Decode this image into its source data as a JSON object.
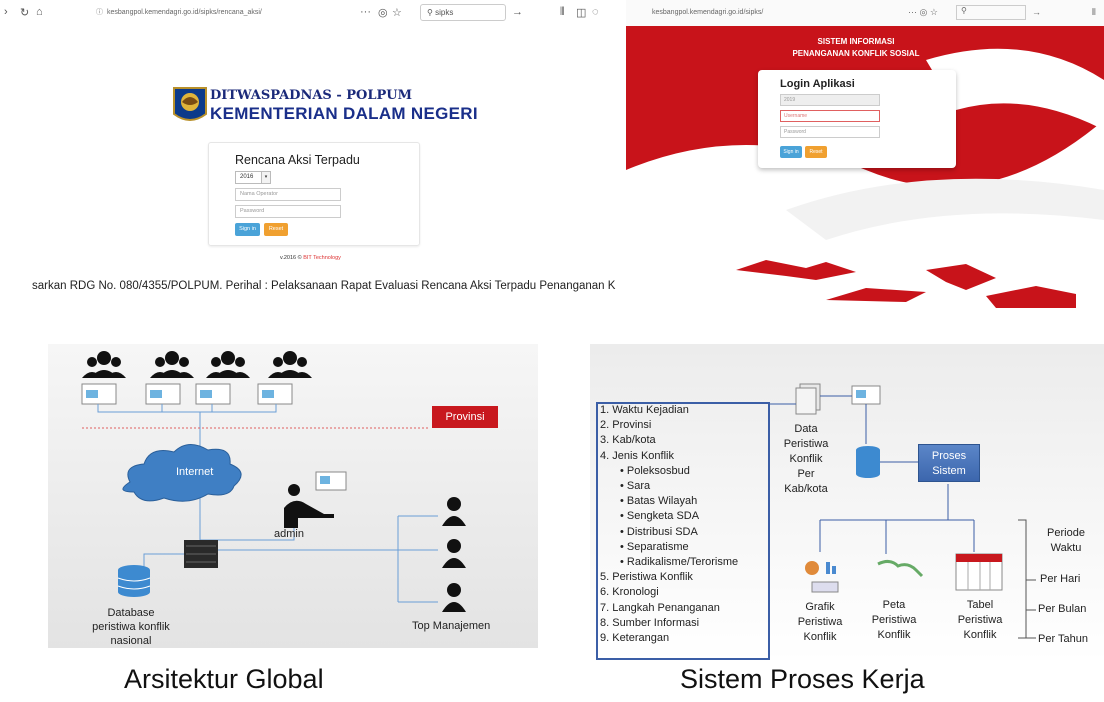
{
  "panel_a": {
    "url": "kesbangpol.kemendagri.go.id/sipks/rencana_aksi/",
    "search_value": "sipks",
    "org_line1": "DITWASPADNAS - POLPUM",
    "org_line2": "KEMENTERIAN DALAM NEGERI",
    "card_title": "Rencana Aksi Terpadu",
    "year_select": "2016",
    "operator_placeholder": "Nama Operator",
    "password_placeholder": "Password",
    "signin_label": "Sign in",
    "reset_label": "Reset",
    "footer_prefix": "v.2016 ©",
    "footer_brand": "BIT Technology",
    "marquee_text": "sarkan RDG No. 080/4355/POLPUM. Perihal : Pelaksanaan Rapat Evaluasi Rencana Aksi Terpadu Penanganan K"
  },
  "panel_b": {
    "url": "kesbangpol.kemendagri.go.id/sipks/",
    "header_line1": "SISTEM INFORMASI",
    "header_line2": "PENANGANAN KONFLIK SOSIAL",
    "card_title": "Login Aplikasi",
    "year_value": "2019",
    "username_placeholder": "Username",
    "password_placeholder": "Password",
    "signin_label": "Sign in",
    "reset_label": "Reset"
  },
  "panel_c": {
    "province_label": "Provinsi",
    "internet_label": "Internet",
    "admin_label": "admin",
    "database_label_1": "Database",
    "database_label_2": "peristiwa konflik",
    "database_label_3": "nasional",
    "top_mgmt_label": "Top Manajemen"
  },
  "panel_d": {
    "items": [
      "1.  Waktu Kejadian",
      "2.  Provinsi",
      "3.  Kab/kota",
      "4.  Jenis Konflik",
      "•    Poleksosbud",
      "•    Sara",
      "•    Batas Wilayah",
      "•    Sengketa SDA",
      "•    Distribusi SDA",
      "•    Separatisme",
      "•    Radikalisme/Terorisme",
      "5.  Peristiwa Konflik",
      "6.  Kronologi",
      "7.  Langkah Penanganan",
      "8.  Sumber Informasi",
      "9.  Keterangan"
    ],
    "data_label_1": "Data",
    "data_label_2": "Peristiwa",
    "data_label_3": "Konflik",
    "data_label_4": "Per",
    "data_label_5": "Kab/kota",
    "proses_1": "Proses",
    "proses_2": "Sistem",
    "grafik_1": "Grafik",
    "grafik_2": "Peristiwa",
    "grafik_3": "Konflik",
    "peta_1": "Peta",
    "peta_2": "Peristiwa",
    "peta_3": "Konflik",
    "tabel_1": "Tabel",
    "tabel_2": "Peristiwa",
    "tabel_3": "Konflik",
    "periode_1": "Periode",
    "periode_2": "Waktu",
    "per_hari": "Per Hari",
    "per_bulan": "Per Bulan",
    "per_tahun": "Per Tahun"
  },
  "captions": {
    "left": "Arsitektur Global",
    "right": "Sistem Proses Kerja"
  },
  "colors": {
    "brand_blue": "#1a2f8a",
    "alert_red": "#c8131a",
    "button_blue": "#4aa3d8",
    "button_orange": "#f0a030"
  }
}
